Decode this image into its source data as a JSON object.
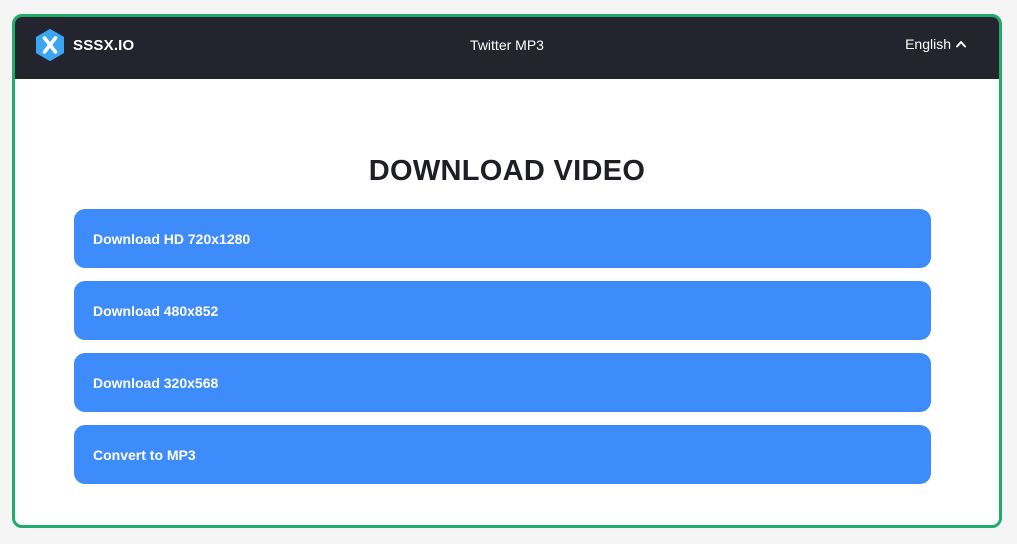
{
  "header": {
    "brand_name": "SSSX.IO",
    "nav_link": "Twitter MP3",
    "language": "English"
  },
  "main": {
    "heading": "DOWNLOAD VIDEO",
    "buttons": [
      {
        "label": "Download HD 720x1280"
      },
      {
        "label": "Download 480x852"
      },
      {
        "label": "Download 320x568"
      },
      {
        "label": "Convert to MP3"
      }
    ]
  },
  "colors": {
    "header_bg": "#23242e",
    "button_bg": "#3e8cfb",
    "frame_border": "#1fab6a",
    "logo": "#3aa6f2"
  },
  "icons": [
    "x-logo-icon",
    "chevron-up-icon"
  ]
}
